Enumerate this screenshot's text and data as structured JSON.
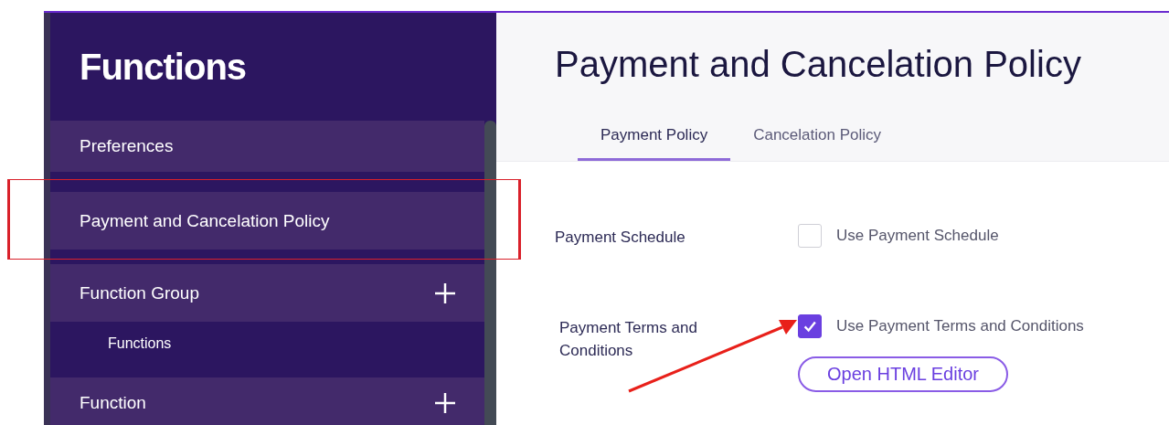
{
  "sidebar": {
    "title": "Functions",
    "items": [
      {
        "kind": "item",
        "label": "Preferences"
      },
      {
        "kind": "item",
        "label": "Payment and Cancelation Policy"
      },
      {
        "kind": "group",
        "label": "Function Group",
        "children": [
          {
            "kind": "subitem",
            "label": "Functions"
          }
        ]
      },
      {
        "kind": "group",
        "label": "Function"
      }
    ]
  },
  "page": {
    "title": "Payment and Cancelation Policy",
    "tabs": [
      {
        "label": "Payment Policy",
        "selected": true
      },
      {
        "label": "Cancelation Policy",
        "selected": false
      }
    ],
    "rows": [
      {
        "label": "Payment Schedule",
        "option": "Use Payment Schedule",
        "checked": false
      },
      {
        "label": "Payment Terms and Conditions",
        "option": "Use Payment Terms and Conditions",
        "checked": true,
        "button": "Open HTML Editor"
      }
    ]
  }
}
